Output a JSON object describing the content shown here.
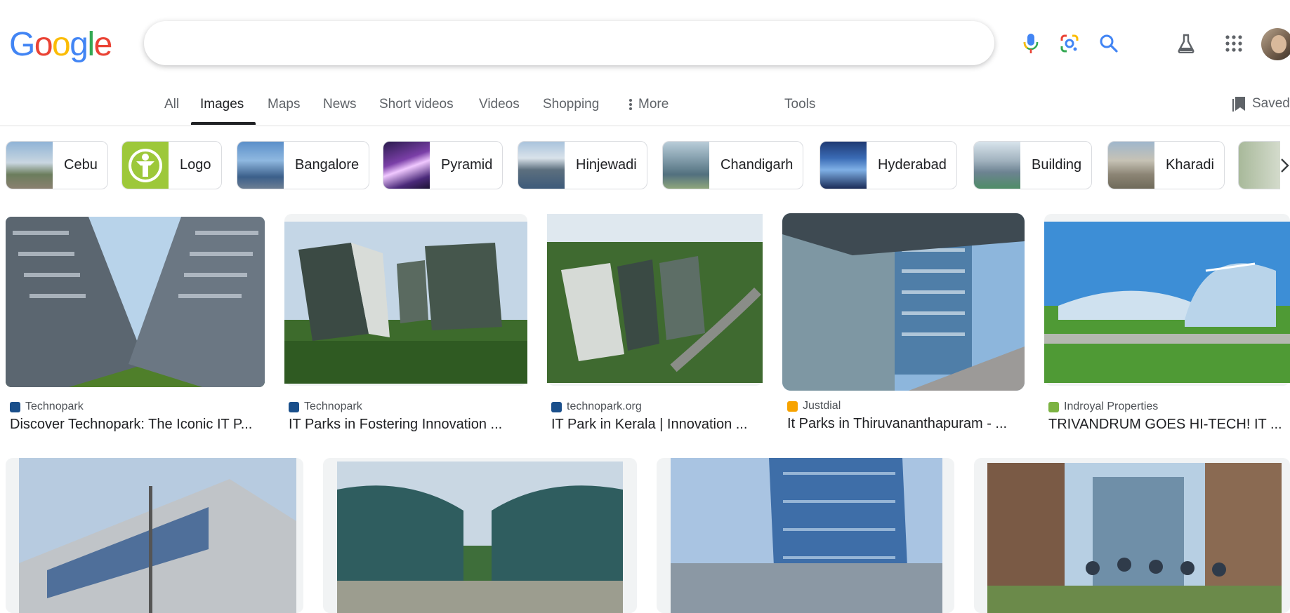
{
  "logo": {
    "letters": [
      "G",
      "o",
      "o",
      "g",
      "l",
      "e"
    ]
  },
  "search": {
    "value": "",
    "placeholder": ""
  },
  "icons": {
    "mic": "microphone-icon",
    "lens": "google-lens-icon",
    "search": "magnifier-icon",
    "labs": "labs-flask-icon",
    "apps": "apps-grid-icon",
    "saved": "bookmark-icon",
    "chip_next": "chevron-right-icon"
  },
  "tabs": [
    {
      "label": "All"
    },
    {
      "label": "Images"
    },
    {
      "label": "Maps"
    },
    {
      "label": "News"
    },
    {
      "label": "Short videos"
    },
    {
      "label": "Videos"
    },
    {
      "label": "Shopping"
    },
    {
      "label": "More"
    },
    {
      "label": "Tools"
    }
  ],
  "saved_label": "Saved",
  "chips": [
    {
      "label": "Cebu"
    },
    {
      "label": "Logo"
    },
    {
      "label": "Bangalore"
    },
    {
      "label": "Pyramid"
    },
    {
      "label": "Hinjewadi"
    },
    {
      "label": "Chandigarh"
    },
    {
      "label": "Hyderabad"
    },
    {
      "label": "Building"
    },
    {
      "label": "Kharadi"
    }
  ],
  "results": [
    {
      "source": "Technopark",
      "title": "Discover Technopark: The Iconic IT P..."
    },
    {
      "source": "Technopark",
      "title": "IT Parks in Fostering Innovation ..."
    },
    {
      "source": "technopark.org",
      "title": "IT Park in Kerala | Innovation ..."
    },
    {
      "source": "Justdial",
      "title": "It Parks in Thiruvananthapuram - ..."
    },
    {
      "source": "Indroyal Properties",
      "title": "TRIVANDRUM GOES HI-TECH! IT ..."
    }
  ],
  "colors": {
    "google_blue": "#4285f4",
    "google_red": "#ea4335",
    "google_yellow": "#fbbc05",
    "google_green": "#34a853",
    "technopark_favicon": "#1a4f8b",
    "justdial_favicon": "#f7a300",
    "indroyal_favicon": "#7cb342"
  }
}
